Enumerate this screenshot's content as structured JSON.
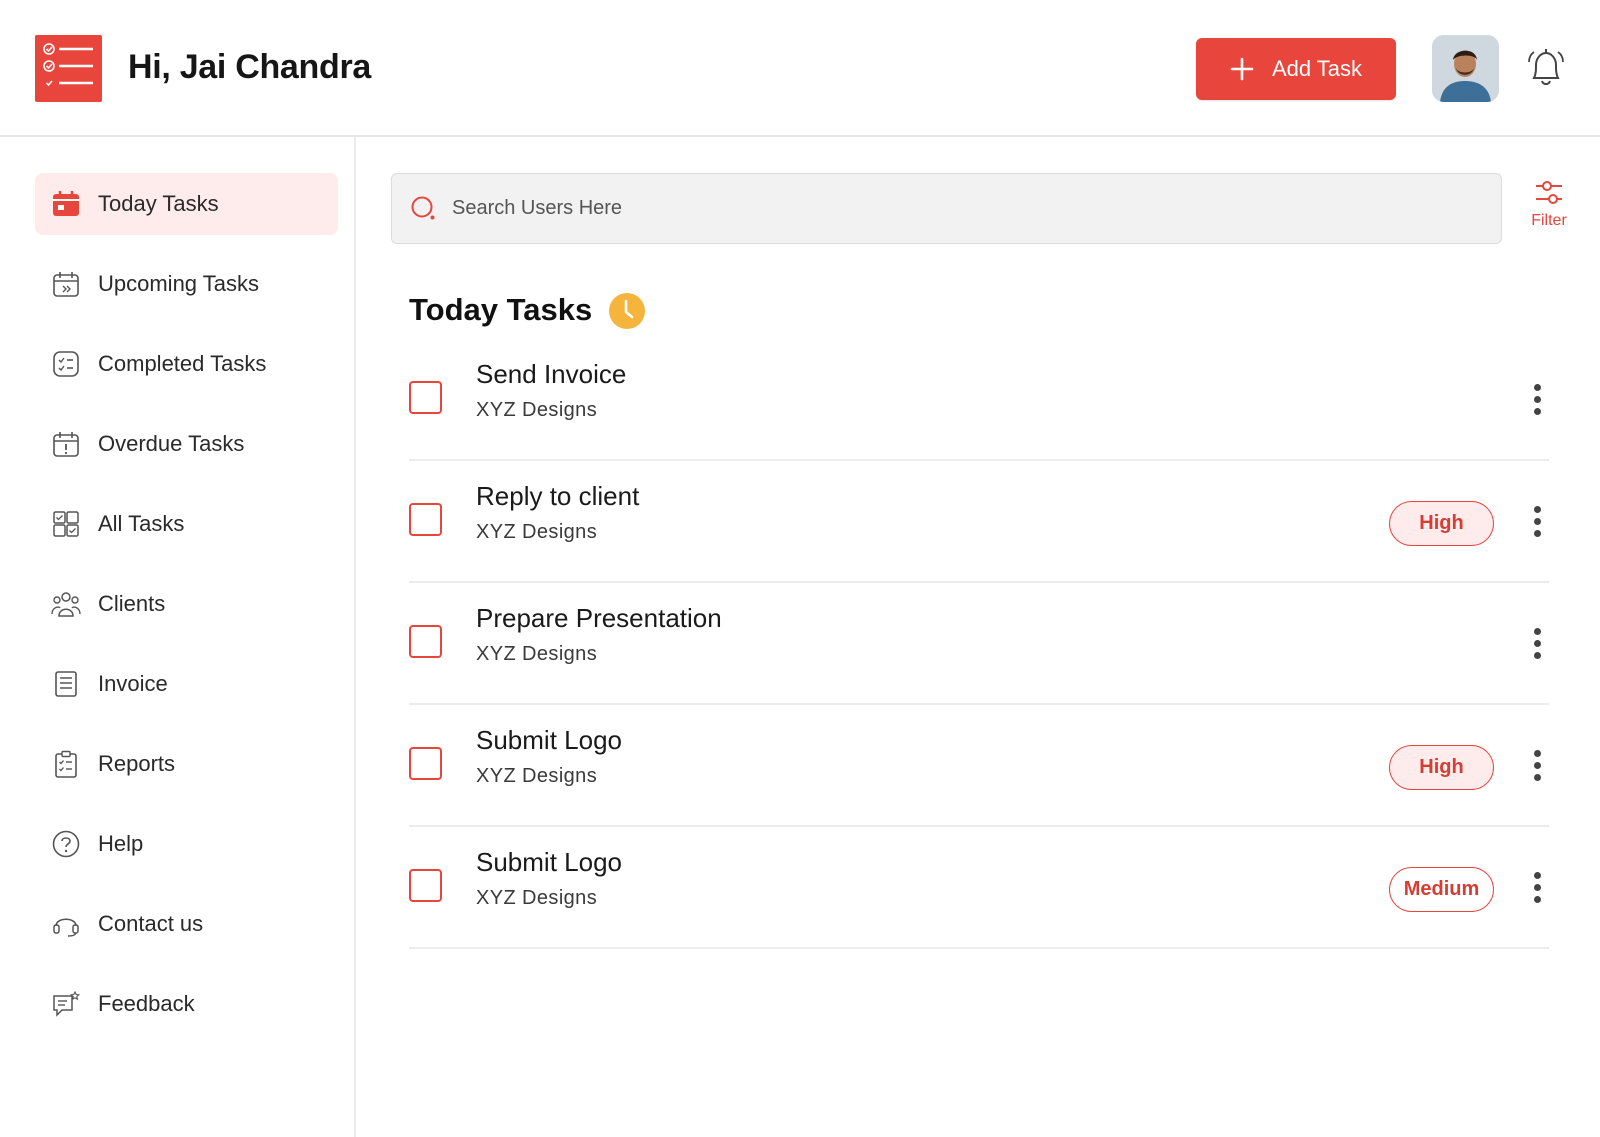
{
  "header": {
    "greeting": "Hi, Jai Chandra",
    "add_task_label": "Add Task",
    "accent_color": "#e8453c"
  },
  "sidebar": {
    "items": [
      {
        "label": "Today Tasks",
        "icon": "calendar-today-icon",
        "active": true
      },
      {
        "label": "Upcoming Tasks",
        "icon": "calendar-forward-icon",
        "active": false
      },
      {
        "label": "Completed Tasks",
        "icon": "checklist-icon",
        "active": false
      },
      {
        "label": "Overdue Tasks",
        "icon": "calendar-alert-icon",
        "active": false
      },
      {
        "label": "All Tasks",
        "icon": "grid-check-icon",
        "active": false
      },
      {
        "label": "Clients",
        "icon": "people-icon",
        "active": false
      },
      {
        "label": "Invoice",
        "icon": "document-icon",
        "active": false
      },
      {
        "label": "Reports",
        "icon": "clipboard-icon",
        "active": false
      },
      {
        "label": "Help",
        "icon": "question-icon",
        "active": false
      },
      {
        "label": "Contact us",
        "icon": "headset-icon",
        "active": false
      },
      {
        "label": "Feedback",
        "icon": "feedback-icon",
        "active": false
      }
    ]
  },
  "search": {
    "placeholder": "Search Users Here",
    "value": ""
  },
  "filter": {
    "label": "Filter"
  },
  "main": {
    "title": "Today Tasks"
  },
  "tasks": [
    {
      "title": "Send Invoice",
      "client": "XYZ Designs",
      "priority": ""
    },
    {
      "title": "Reply to client",
      "client": "XYZ Designs",
      "priority": "High"
    },
    {
      "title": "Prepare Presentation",
      "client": "XYZ Designs",
      "priority": ""
    },
    {
      "title": "Submit Logo",
      "client": "XYZ Designs",
      "priority": "High"
    },
    {
      "title": "Submit Logo",
      "client": "XYZ Designs",
      "priority": "Medium"
    }
  ]
}
